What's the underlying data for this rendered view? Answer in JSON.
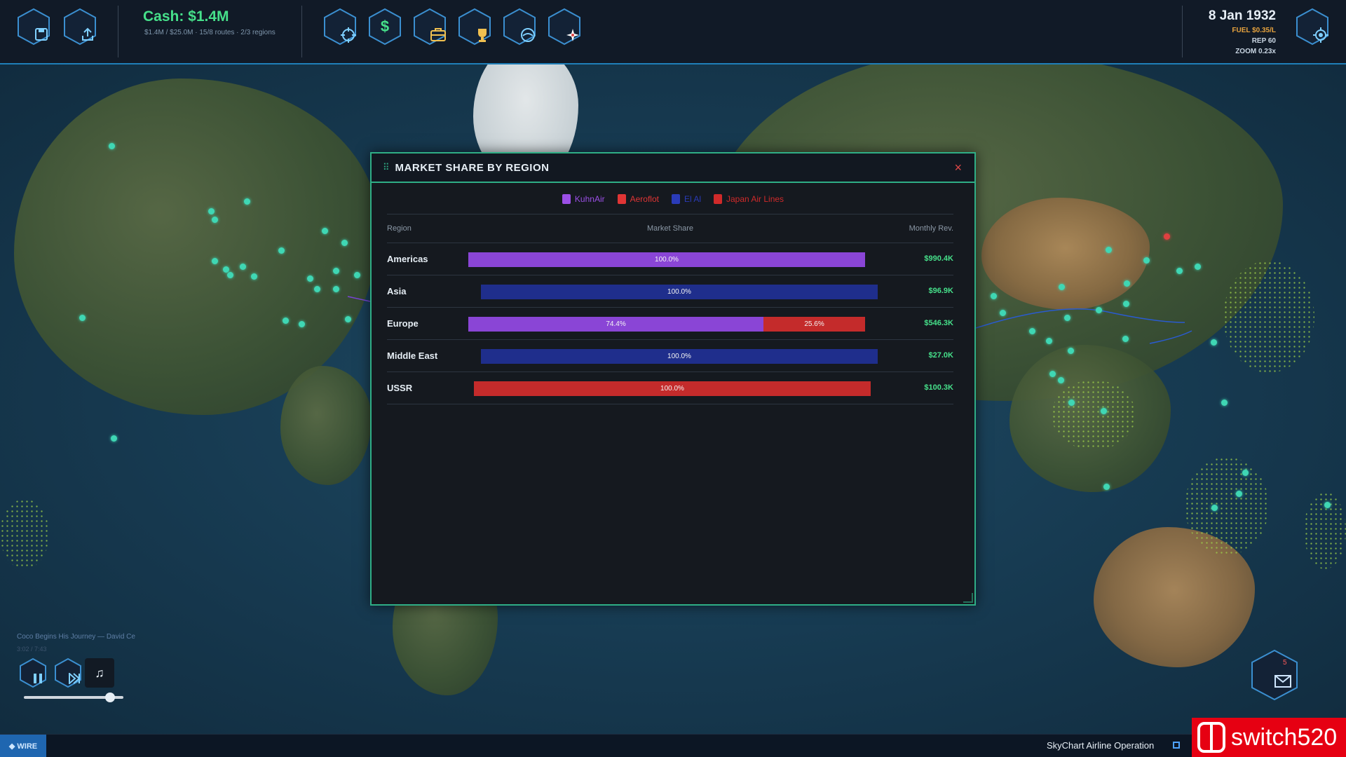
{
  "topbar": {
    "cash": "Cash: $1.4M",
    "cash_sub": "$1.4M / $25.0M  ·  15/8 routes  ·  2/3 regions",
    "date": "8 Jan 1932",
    "fuel": "FUEL $0.35/L",
    "rep": "REP 60",
    "zoom": "ZOOM 0.23x",
    "icons": {
      "save": "save-icon",
      "export": "export-icon",
      "target": "crosshair-icon",
      "finance": "$",
      "briefcase": "briefcase-icon",
      "trophy": "trophy-icon",
      "aircraft": "aircraft-icon",
      "compass": "compass-icon",
      "settings": "settings-icon"
    }
  },
  "modal": {
    "title": "MARKET SHARE BY REGION",
    "close": "×",
    "legend": [
      {
        "name": "KuhnAir",
        "color": "#9b4fe6"
      },
      {
        "name": "Aeroflot",
        "color": "#e03535"
      },
      {
        "name": "El Al",
        "color": "#2a3bb8"
      },
      {
        "name": "Japan Air Lines",
        "color": "#d02a2a"
      }
    ],
    "headers": {
      "region": "Region",
      "share": "Market Share",
      "rev": "Monthly Rev."
    },
    "rows": [
      {
        "region": "Americas",
        "revenue": "$990.4K",
        "segments": [
          {
            "label": "100.0%",
            "share": 100,
            "color": "#8a45d6"
          }
        ]
      },
      {
        "region": "Asia",
        "revenue": "$96.9K",
        "segments": [
          {
            "label": "100.0%",
            "share": 100,
            "color": "#1f2e8c"
          }
        ]
      },
      {
        "region": "Europe",
        "revenue": "$546.3K",
        "segments": [
          {
            "label": "74.4%",
            "share": 74.4,
            "color": "#8a45d6"
          },
          {
            "label": "25.6%",
            "share": 25.6,
            "color": "#c42b2b"
          }
        ]
      },
      {
        "region": "Middle East",
        "revenue": "$27.0K",
        "segments": [
          {
            "label": "100.0%",
            "share": 100,
            "color": "#1f2e8c"
          }
        ]
      },
      {
        "region": "USSR",
        "revenue": "$100.3K",
        "segments": [
          {
            "label": "100.0%",
            "share": 100,
            "color": "#c42b2b"
          }
        ]
      }
    ]
  },
  "music": {
    "song": "Coco Begins His Journey  —  David Ce",
    "time": "3:02 / 7:43",
    "note": "♫",
    "volume": 0.82
  },
  "bottom": {
    "wire": "◆ WIRE",
    "brand": "SkyChart Airline Operation",
    "watermark": "switch520",
    "mail_badge": "5"
  }
}
